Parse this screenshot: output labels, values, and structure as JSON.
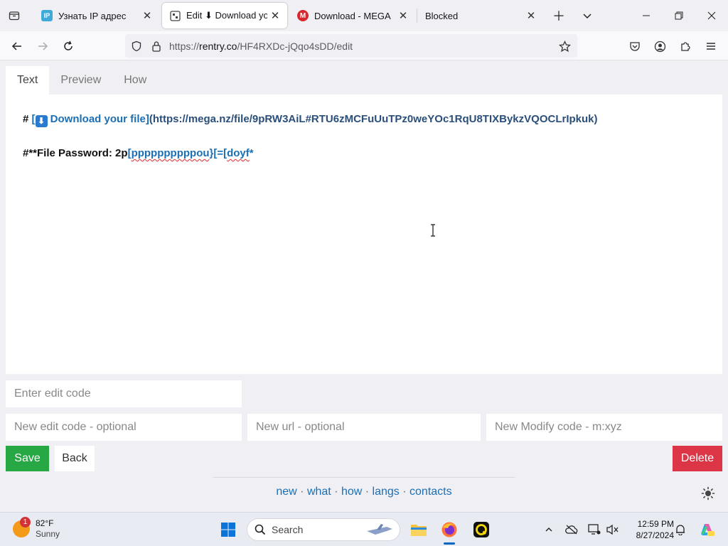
{
  "browser": {
    "tabs": [
      {
        "title": "Узнать IP адрес",
        "favicon_text": "IP",
        "favicon_color": "#3fa9d8",
        "active": false
      },
      {
        "title": "Edit ⬇ Download your f",
        "favicon_text": "",
        "favicon_color": "#ffffff",
        "active": true
      },
      {
        "title": "Download - MEGA",
        "favicon_text": "M",
        "favicon_color": "#d9272e",
        "active": false
      },
      {
        "title": "Blocked",
        "favicon_text": "",
        "favicon_color": "#f0f0f4",
        "active": false
      }
    ],
    "url_prefix": "https://",
    "url_host": "rentry.co",
    "url_path": "/HF4RXDc-jQqo4sDD/edit"
  },
  "page": {
    "tabs": [
      "Text",
      "Preview",
      "How"
    ],
    "editor": {
      "line1_hash": "# ",
      "line1_link_open": "[",
      "line1_link_icon": "⬇",
      "line1_link_text": " Download your file]",
      "line1_url": "(https://mega.nz/file/9pRW3AiL#RTU6zMCFuUuTPz0weYOc1RqU8TIXBykzVQOCLrIpkuk)",
      "line2_prefix": "#**File Password: 2p",
      "line2_bracket": "[",
      "line2_misspelled": "ppppppppppou",
      "line2_mid": "}[=[",
      "line2_misspelled2": "doyf",
      "line2_end": "*"
    },
    "inputs": {
      "edit_code_placeholder": "Enter edit code",
      "new_edit_code_placeholder": "New edit code - optional",
      "new_url_placeholder": "New url - optional",
      "new_modify_code_placeholder": "New Modify code - m:xyz"
    },
    "buttons": {
      "save": "Save",
      "back": "Back",
      "delete": "Delete"
    },
    "footer": {
      "links": [
        "new",
        "what",
        "how",
        "langs",
        "contacts"
      ],
      "separator": " · "
    }
  },
  "taskbar": {
    "weather_temp": "82°F",
    "weather_desc": "Sunny",
    "weather_badge": "1",
    "search_label": "Search",
    "time": "12:59 PM",
    "date": "8/27/2024"
  },
  "colors": {
    "accent_blue": "#1a6fb5",
    "save_green": "#28a745",
    "delete_red": "#dc3545"
  }
}
